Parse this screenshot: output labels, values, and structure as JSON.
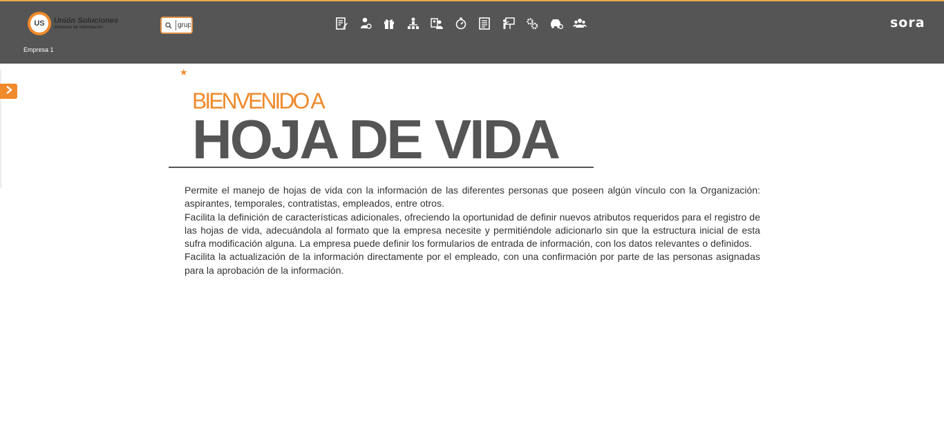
{
  "header": {
    "logo_name": "Unión Soluciones",
    "logo_sub": "Sistemas de Información",
    "logo_mark": "US",
    "company": "Empresa 1",
    "search": {
      "value": "grup"
    },
    "brand": "sora",
    "accent": "#f08a2c",
    "bar_color": "#555555",
    "nav_icons": [
      "resume-icon",
      "person-icon",
      "gift-icon",
      "org-chart-icon",
      "employee-card-icon",
      "timer-icon",
      "document-icon",
      "presentation-icon",
      "gears-icon",
      "vehicle-icon",
      "group-icon"
    ]
  },
  "main": {
    "star": "★",
    "welcome": "BIENVENIDO A",
    "title": "HOJA DE VIDA",
    "paragraphs": [
      "Permite el manejo de hojas de vida con la información de las diferentes personas que poseen algún vínculo con la Organización: aspirantes, temporales, contratistas, empleados, entre otros.",
      "Facilita la definición de características adicionales, ofreciendo la oportunidad de definir nuevos atributos requeridos para el registro de las hojas de vida, adecuándola al formato que la empresa necesite y permitiéndole adicionarlo sin que la estructura inicial de esta sufra modificación alguna. La empresa puede definir los formularios de entrada de información, con los datos relevantes o definidos.",
      "Facilita la actualización de la información directamente por el empleado, con una confirmación por parte de las personas asignadas para la aprobación de la información."
    ]
  }
}
